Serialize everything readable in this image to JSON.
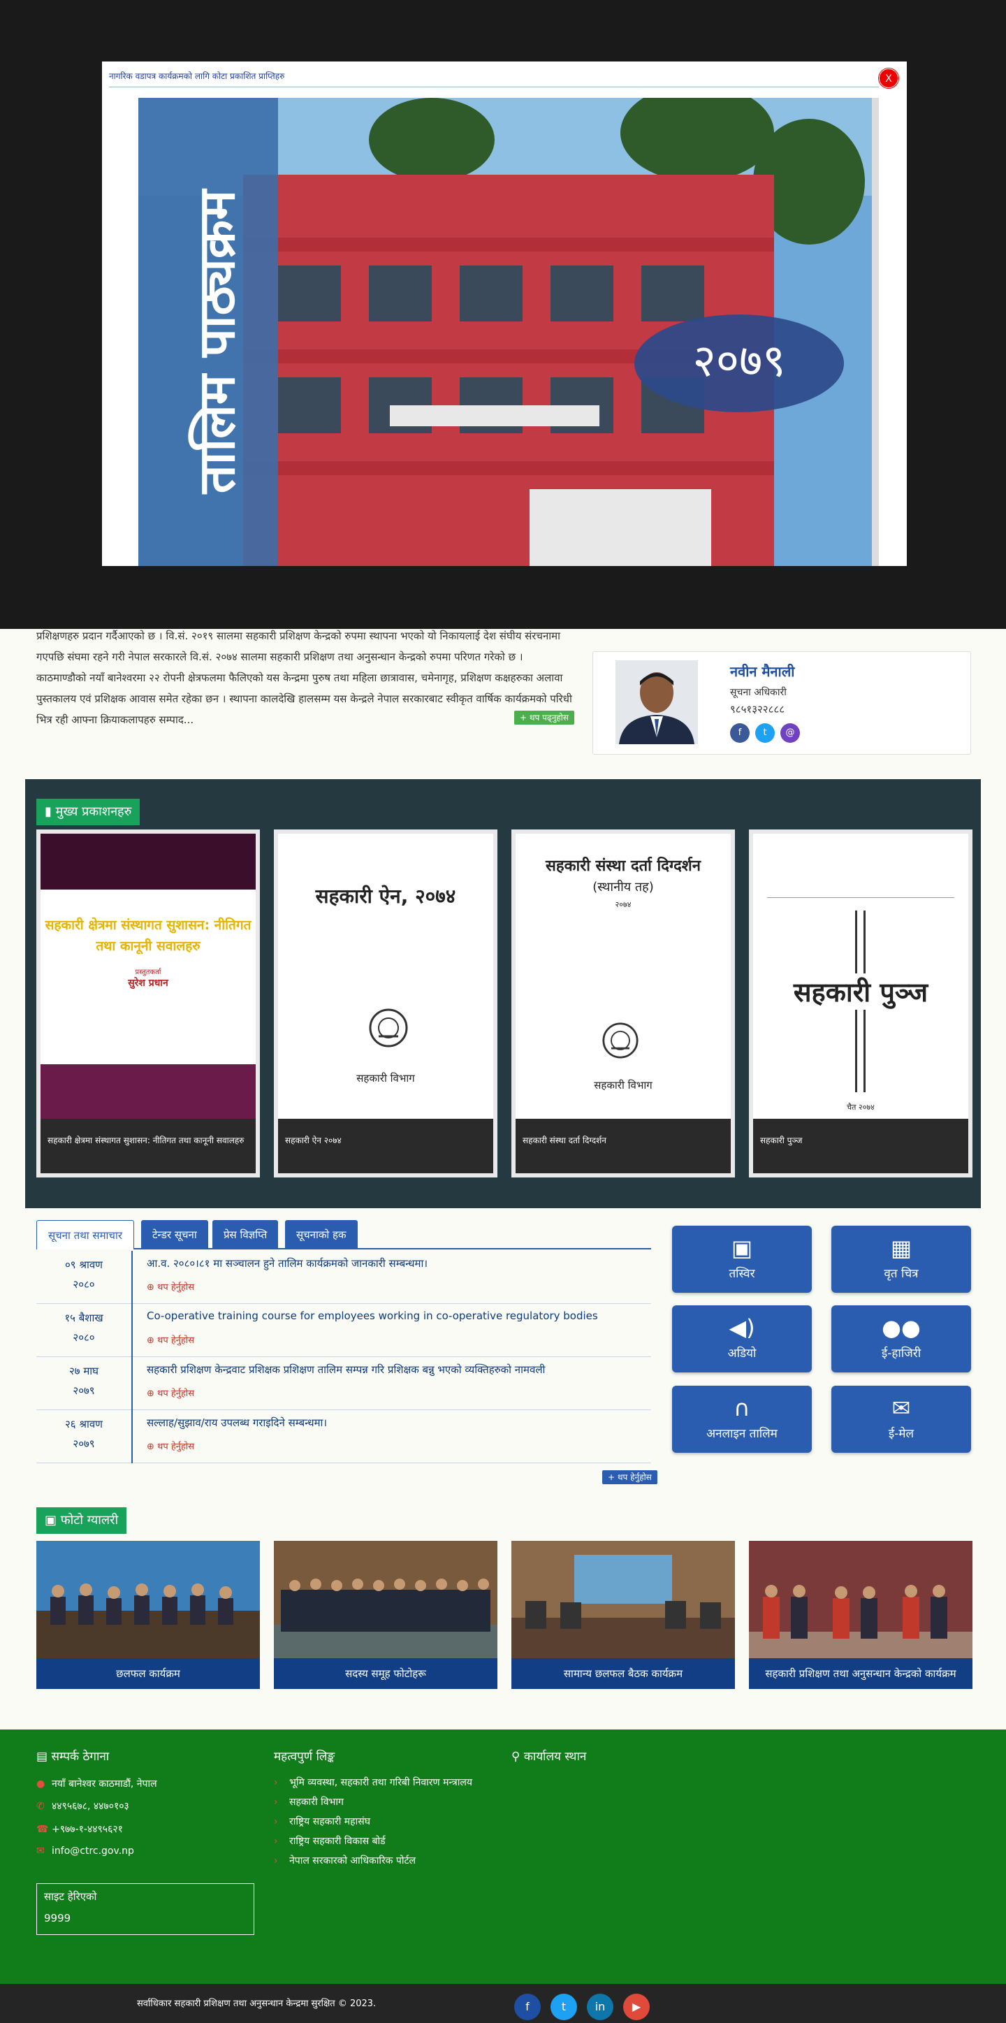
{
  "modal": {
    "title": "नागरिक वडापत्र कार्यक्रमको लागि कोटा प्रकाशित प्राप्तिहरु",
    "close_label": "X",
    "poster_text": "तालिम पाठ्यक्रम",
    "poster_year": "२०७९"
  },
  "intro": {
    "text": "प्रशिक्षणहरु प्रदान गर्दैआएको छ । वि.सं. २०१९ सालमा सहकारी प्रशिक्षण केन्द्रको रुपमा स्थापना भएको यो निकायलाई देश संघीय संरचनामा गएपछि संघमा रहने गरी नेपाल सरकारले वि.सं. २०७४ सालमा सहकारी प्रशिक्षण तथा अनुसन्धान केन्द्रको रुपमा परिणत गरेको छ । काठमाण्डौको नयाँ बानेश्वरमा २२ रोपनी क्षेत्रफलमा फैलिएको यस केन्द्रमा पुरुष तथा महिला छात्रावास, चमेनागृह, प्रशिक्षण कक्षहरुका अलावा पुस्तकालय एवं प्रशिक्षक आवास समेत रहेका छन । स्थापना कालदेखि हालसम्म यस केन्द्रले नेपाल सरकारबाट स्वीकृत वार्षिक कार्यक्रमको परिधी भित्र रही आफ्ना क्रियाकलापहरु सम्पाद...",
    "more_label": "+ थप पढ्नुहोस"
  },
  "profile": {
    "name": "नवीन मैनाली",
    "role": "सूचना अधिकारी",
    "phone": "९८५१३२२८८८",
    "icons": [
      "facebook-icon",
      "twitter-icon",
      "email-icon"
    ]
  },
  "publications": {
    "heading": "मुख्य प्रकाशनहरु",
    "items": [
      {
        "caption": "सहकारी क्षेत्रमा संस्थागत सुशासन: नीतिगत तथा कानूनी सवालहरु",
        "cover_title": "सहकारी क्षेत्रमा संस्थागत सुशासन: नीतिगत तथा कानूनी सवालहरु",
        "cover_author": "सुरेश प्रधान",
        "cover_sub": "प्रस्तुतकर्ता"
      },
      {
        "caption": "सहकारी ऐन २०७४",
        "cover_title": "सहकारी ऐन, २०७४",
        "cover_org": "सहकारी विभाग"
      },
      {
        "caption": "सहकारी संस्था दर्ता दिग्दर्शन",
        "cover_title": "सहकारी संस्था दर्ता दिग्दर्शन",
        "cover_sub": "(स्थानीय तह)",
        "cover_year": "२०७४",
        "cover_org": "सहकारी विभाग"
      },
      {
        "caption": "सहकारी पुञ्ज",
        "cover_title": "सहकारी पुञ्ज",
        "cover_date": "चैत २०७४"
      }
    ]
  },
  "tabs": [
    "सूचना तथा समाचार",
    "टेन्डर सूचना",
    "प्रेस विज्ञप्ति",
    "सूचनाको हक"
  ],
  "news": [
    {
      "day": "०९ श्रावण",
      "year": "२०८०",
      "title": "आ.व. २०८०।८१ मा सञ्चालन हुने तालिम कार्यक्रमको जानकारी सम्बन्धमा।",
      "more": "थप हेर्नुहोस"
    },
    {
      "day": "१५ बैशाख",
      "year": "२०८०",
      "title": "Co-operative training course for employees working in co-operative regulatory bodies",
      "more": "थप हेर्नुहोस"
    },
    {
      "day": "२७ माघ",
      "year": "२०७९",
      "title": "सहकारी प्रशिक्षण केन्द्रवाट प्रशिक्षक प्रशिक्षण तालिम सम्पन्न गरि प्रशिक्षक बन्नु भएको व्यक्तिहरुको नामवली",
      "more": "थप हेर्नुहोस"
    },
    {
      "day": "२६ श्रावण",
      "year": "२०७९",
      "title": "सल्लाह/सुझाव/राय उपलब्ध गराइदिने सम्बन्धमा।",
      "more": "थप हेर्नुहोस"
    }
  ],
  "news_more": "+ थप हेर्नुहोस",
  "quick_links": [
    {
      "label": "तस्विर",
      "icon": "image-icon"
    },
    {
      "label": "वृत चित्र",
      "icon": "film-icon"
    },
    {
      "label": "अडियो",
      "icon": "audio-icon"
    },
    {
      "label": "ई-हाजिरी",
      "icon": "users-icon"
    },
    {
      "label": "अनलाइन तालिम",
      "icon": "headphones-icon"
    },
    {
      "label": "ई-मेल",
      "icon": "mail-icon"
    }
  ],
  "gallery": {
    "heading": "फोटो ग्यालरी",
    "items": [
      "छलफल कार्यक्रम",
      "सदस्य समूह फोटोहरू",
      "सामान्य छलफल बैठक कार्यक्रम",
      "सहकारी प्रशिक्षण तथा अनुसन्धान केन्द्रको कार्यक्रम"
    ]
  },
  "footer": {
    "contact_heading": "सम्पर्क ठेगाना",
    "address": "नयाँ बानेश्वर काठमाडौं, नेपाल",
    "phone": "४४९५६७८, ४४७०१०३",
    "fax": "+९७७-१-४४९५६२१",
    "email": "info@ctrc.gov.np",
    "links_heading": "महत्वपुर्ण लिङ्क",
    "links": [
      "भूमि व्यवस्था, सहकारी तथा गरिबी निवारण मन्त्रालय",
      "सहकारी विभाग",
      "राष्ट्रिय सहकारी महासंघ",
      "राष्ट्रिय सहकारी विकास बोर्ड",
      "नेपाल सरकारको आधिकारिक पोर्टल"
    ],
    "office_heading": "कार्यालय स्थान",
    "visits_label": "साइट हेरिएको",
    "visits_count": "9999",
    "copyright": "सर्वाधिकार सहकारी प्रशिक्षण तथा अनुसन्धान केन्द्रमा सुरक्षित © 2023.",
    "social": [
      "facebook-icon",
      "twitter-icon",
      "linkedin-icon",
      "youtube-icon"
    ]
  },
  "colors": {
    "primary": "#2a5db0",
    "footer": "#117c1a",
    "section_green": "#19a35a",
    "panel": "#253a40",
    "close": "#ee0000"
  }
}
